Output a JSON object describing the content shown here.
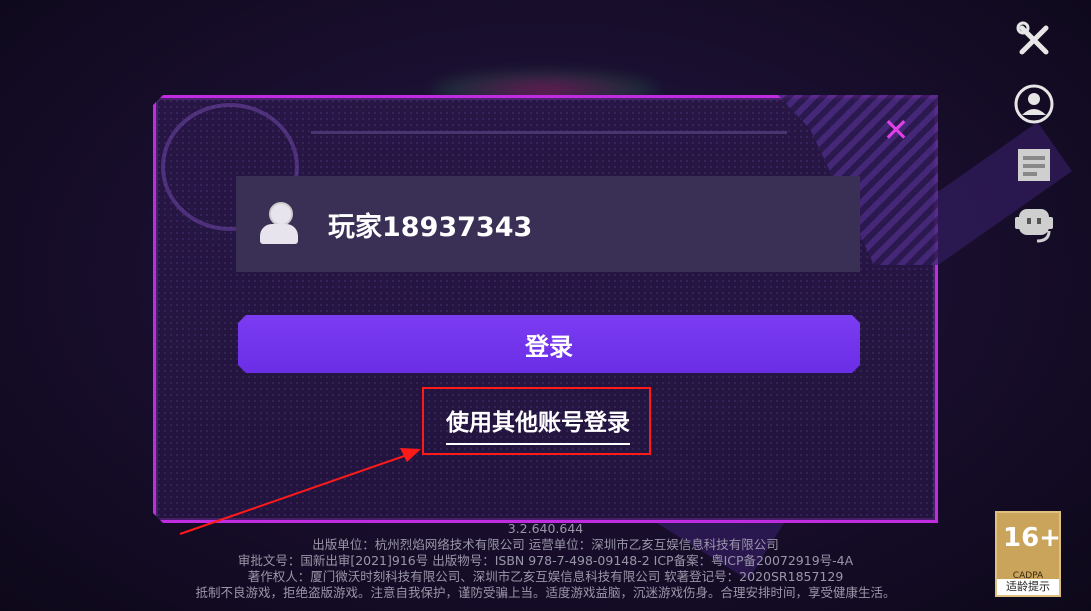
{
  "dialog": {
    "close_symbol": "✕",
    "account_name": "玩家18937343",
    "login_label": "登录",
    "other_login_label": "使用其他账号登录"
  },
  "sidebar": {
    "icons": [
      "tools-icon",
      "account-icon",
      "notice-icon",
      "customer-service-icon"
    ]
  },
  "footer": {
    "version": "3.2.640.644",
    "line1": "出版单位：杭州烈焰网络技术有限公司 运营单位：深圳市乙亥互娱信息科技有限公司",
    "line2": "审批文号：国新出审[2021]916号 出版物号：ISBN 978-7-498-09148-2 ICP备案：粤ICP备20072919号-4A",
    "line3": "著作权人：厦门微沃时刻科技有限公司、深圳市乙亥互娱信息科技有限公司 软著登记号：2020SR1857129",
    "line4": "抵制不良游戏，拒绝盗版游戏。注意自我保护，谨防受骗上当。适度游戏益脑，沉迷游戏伤身。合理安排时间，享受健康生活。"
  },
  "age_badge": {
    "rating": "16+",
    "org": "CADPA",
    "tip": "适龄提示"
  },
  "colors": {
    "accent": "#c02de0",
    "button": "#6a2ee6",
    "highlight": "#ff1a1a"
  }
}
